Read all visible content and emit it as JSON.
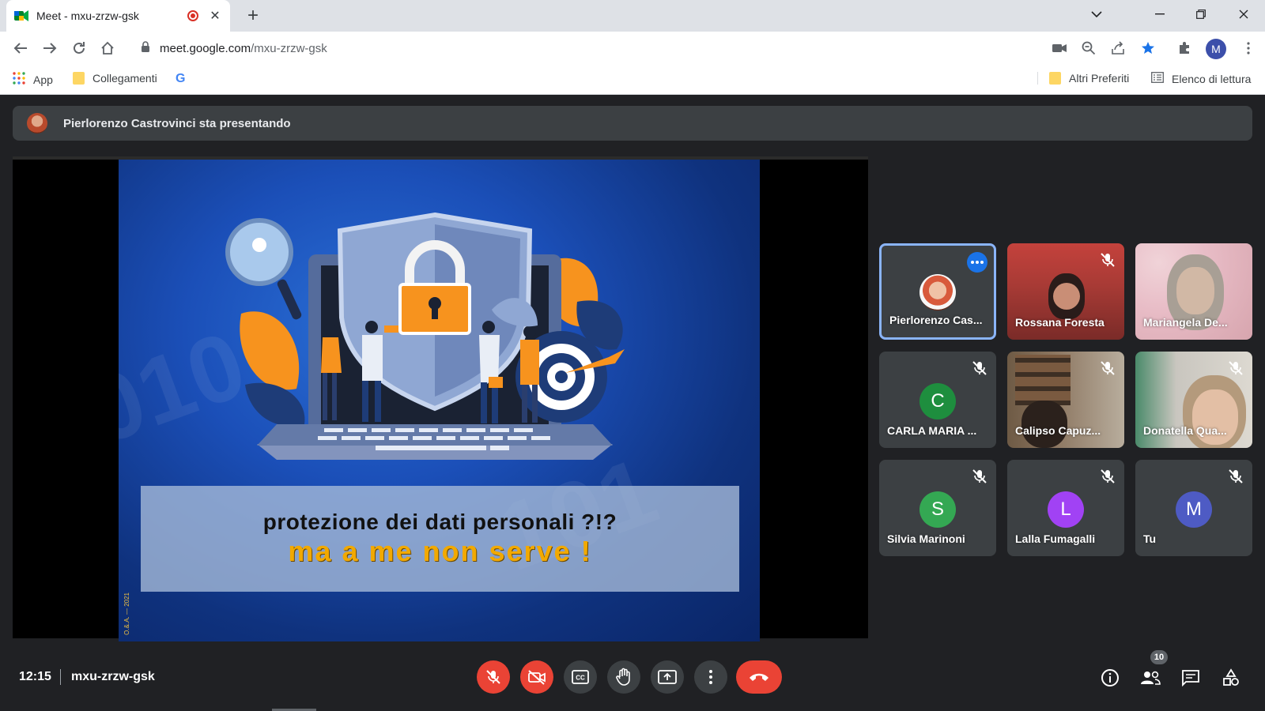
{
  "browser": {
    "tab_title": "Meet - mxu-zrzw-gsk",
    "url_host": "meet.google.com",
    "url_path": "/mxu-zrzw-gsk",
    "profile_initial": "M",
    "bookmarks": {
      "apps": "App",
      "links": "Collegamenti",
      "other": "Altri Preferiti",
      "reading_list": "Elenco di lettura"
    }
  },
  "meet": {
    "presenting_text": "Pierlorenzo Castrovinci sta presentando",
    "slide": {
      "line1": "protezione dei dati personali ?!?",
      "line2": "ma a me non serve !",
      "credit": "O.&.A. — 2021"
    },
    "participants": [
      {
        "name": "Pierlorenzo Cas...",
        "kind": "photo",
        "active": true,
        "muted": false
      },
      {
        "name": "Rossana Foresta",
        "kind": "video",
        "muted": true
      },
      {
        "name": "Mariangela De...",
        "kind": "video",
        "muted": false
      },
      {
        "name": "CARLA MARIA ...",
        "initial": "C",
        "color": "#1e8e3e",
        "muted": true
      },
      {
        "name": "Calipso Capuz...",
        "kind": "video",
        "muted": true
      },
      {
        "name": "Donatella Qua...",
        "kind": "video",
        "muted": true
      },
      {
        "name": "Silvia Marinoni",
        "initial": "S",
        "color": "#34a853",
        "muted": true
      },
      {
        "name": "Lalla Fumagalli",
        "initial": "L",
        "color": "#a142f4",
        "muted": true
      },
      {
        "name": "Tu",
        "initial": "M",
        "color": "#4e5bc4",
        "muted": true
      }
    ],
    "time": "12:15",
    "meeting_code": "mxu-zrzw-gsk",
    "people_count": "10",
    "colors": {
      "accent": "#8ab4f8",
      "danger": "#ea4335",
      "bg": "#202124",
      "tile": "#3c4043"
    }
  }
}
